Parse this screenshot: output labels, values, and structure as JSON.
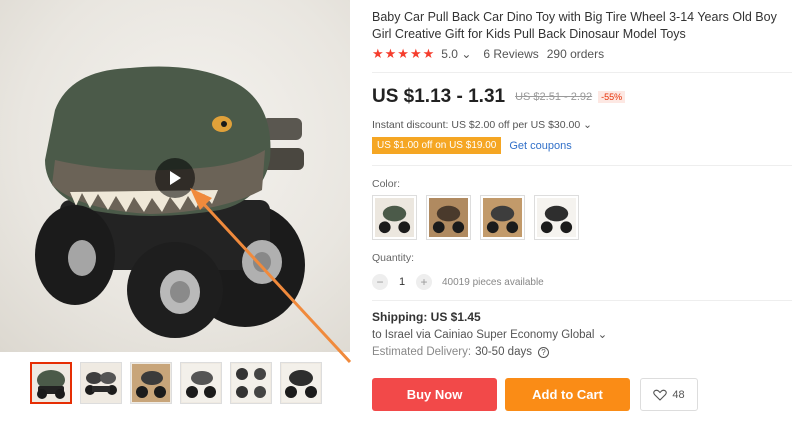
{
  "product": {
    "title": "Baby Car Pull Back Car Dino Toy with Big Tire Wheel 3-14 Years Old Boy Girl Creative Gift for Kids Pull Back Dinosaur Model Toys",
    "rating": "5.0",
    "reviews": "6 Reviews",
    "orders": "290 orders",
    "stars": "★★★★★",
    "price": "US $1.13 - 1.31",
    "old_price": "US $2.51 - 2.92",
    "discount": "-55%",
    "instant_discount": "Instant discount: US $2.00 off per US $30.00 ⌄",
    "coupon_tag": "US $1.00 off on US $19.00",
    "get_coupons": "Get coupons",
    "color_label": "Color:",
    "quantity_label": "Quantity:",
    "quantity_value": "1",
    "quantity_minus": "−",
    "quantity_plus": "+",
    "available": "40019 pieces available",
    "shipping": "Shipping: US $1.45",
    "ship_to": "to Israel via Cainiao Super Economy Global ⌄",
    "delivery_label": "Estimated Delivery:",
    "delivery_value": "30-50 days",
    "help_glyph": "?",
    "buy_now": "Buy Now",
    "add_to_cart": "Add to Cart",
    "wishlist_count": "48",
    "rating_caret": "⌄"
  },
  "colors": {
    "accent_red": "#f24949",
    "accent_orange": "#fa8c16",
    "star_red": "#f53d2d",
    "link_blue": "#3170c9",
    "annotation_arrow": "#f08a3c"
  },
  "icons": {
    "play": "play-icon",
    "heart": "heart-icon",
    "help": "help-icon"
  }
}
